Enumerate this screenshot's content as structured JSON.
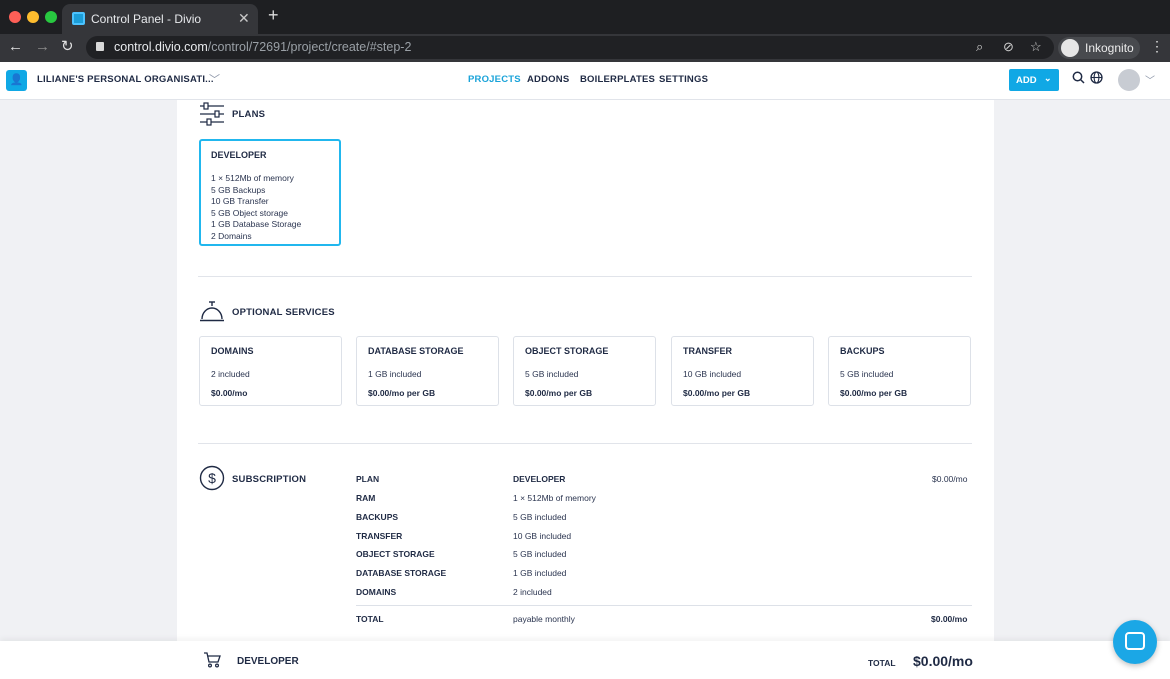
{
  "browser": {
    "tab_title": "Control Panel - Divio",
    "url_domain": "control.divio.com",
    "url_path": "/control/72691/project/create/#step-2",
    "incognito_label": "Inkognito"
  },
  "header": {
    "org_name": "LILIANE'S PERSONAL ORGANISATI...",
    "nav": [
      "PROJECTS",
      "ADDONS",
      "BOILERPLATES",
      "SETTINGS"
    ],
    "active_nav": "PROJECTS",
    "add_label": "ADD"
  },
  "plans": {
    "title": "PLANS",
    "selected": {
      "name": "DEVELOPER",
      "features": [
        "1 × 512Mb of memory",
        "5 GB Backups",
        "10 GB Transfer",
        "5 GB Object storage",
        "1 GB Database Storage",
        "2 Domains"
      ]
    }
  },
  "optional_services": {
    "title": "OPTIONAL SERVICES",
    "items": [
      {
        "name": "DOMAINS",
        "included": "2 included",
        "price": "$0.00/mo"
      },
      {
        "name": "DATABASE STORAGE",
        "included": "1 GB included",
        "price": "$0.00/mo per GB"
      },
      {
        "name": "OBJECT STORAGE",
        "included": "5 GB included",
        "price": "$0.00/mo per GB"
      },
      {
        "name": "TRANSFER",
        "included": "10 GB included",
        "price": "$0.00/mo per GB"
      },
      {
        "name": "BACKUPS",
        "included": "5 GB included",
        "price": "$0.00/mo per GB"
      }
    ]
  },
  "subscription": {
    "title": "SUBSCRIPTION",
    "rows": [
      {
        "label": "PLAN",
        "value": "DEVELOPER",
        "price": "$0.00/mo"
      },
      {
        "label": "RAM",
        "value": "1 × 512Mb of memory",
        "price": ""
      },
      {
        "label": "BACKUPS",
        "value": "5 GB included",
        "price": ""
      },
      {
        "label": "TRANSFER",
        "value": "10 GB included",
        "price": ""
      },
      {
        "label": "OBJECT STORAGE",
        "value": "5 GB included",
        "price": ""
      },
      {
        "label": "DATABASE STORAGE",
        "value": "1 GB included",
        "price": ""
      },
      {
        "label": "DOMAINS",
        "value": "2 included",
        "price": ""
      }
    ],
    "total": {
      "label": "TOTAL",
      "value": "payable monthly",
      "price": "$0.00/mo"
    }
  },
  "bottom_bar": {
    "plan": "DEVELOPER",
    "total_label": "TOTAL",
    "total": "$0.00/mo"
  },
  "colors": {
    "accent": "#10a8e5",
    "text": "#1f2a44",
    "selected_border": "#21b7ee"
  }
}
